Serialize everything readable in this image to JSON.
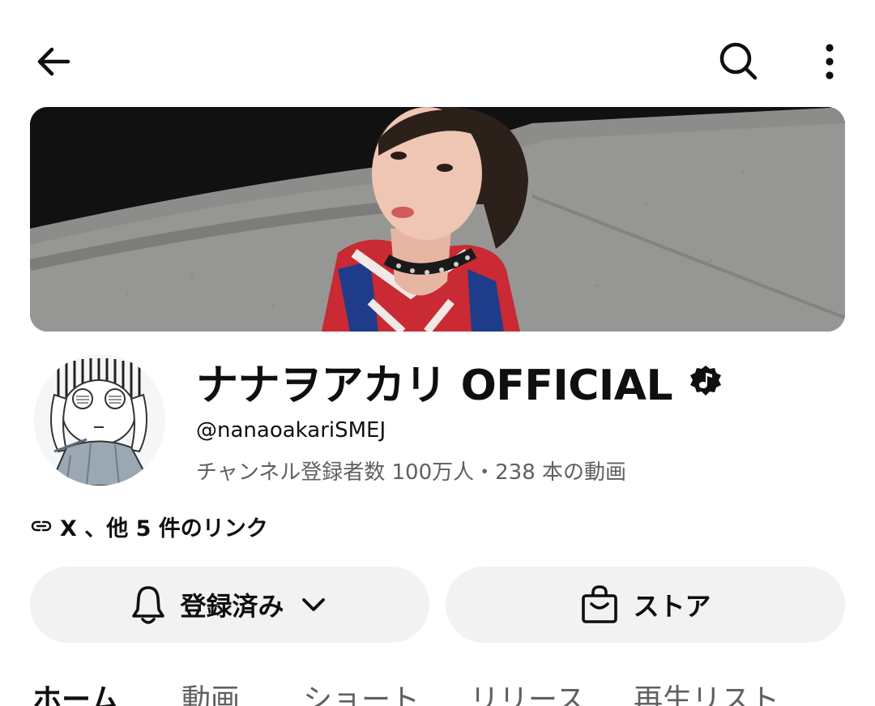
{
  "header": {
    "back_icon": "arrow-left-icon",
    "search_icon": "search-icon",
    "more_icon": "more-vert-icon"
  },
  "channel": {
    "title": "ナナヲアカリ OFFICIAL",
    "verified_icon": "music-note-badge-icon",
    "handle": "@nanaoakariSMEJ",
    "stats": "チャンネル登録者数 100万人・238 本の動画",
    "links_text": "X 、他 5 件のリンク"
  },
  "actions": {
    "subscribe_label": "登録済み",
    "subscribe_icon": "bell-icon",
    "subscribe_chevron": "chevron-down-icon",
    "store_label": "ストア",
    "store_icon": "shopping-bag-icon"
  },
  "tabs": [
    {
      "label": "ホーム"
    },
    {
      "label": "動画"
    },
    {
      "label": "ショート"
    },
    {
      "label": "リリース"
    },
    {
      "label": "再生リスト"
    }
  ],
  "colors": {
    "text_primary": "#0f0f0f",
    "text_secondary": "#606060",
    "button_bg": "#f2f2f2"
  }
}
